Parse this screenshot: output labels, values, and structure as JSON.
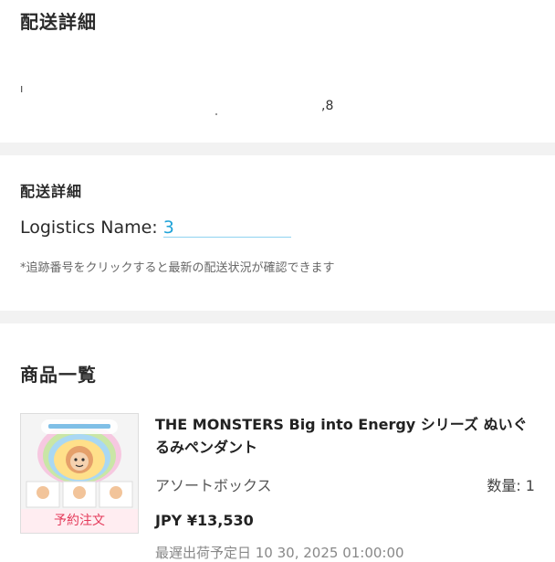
{
  "shipping_section": {
    "title": "配送詳細",
    "redacted_line_start": "ı",
    "redacted_line_end": ",8"
  },
  "logistics_section": {
    "title": "配送詳細",
    "logistics_label": "Logistics Name:",
    "tracking_link_text": "3",
    "note": "*追跡番号をクリックすると最新の配送状況が確認できます"
  },
  "products_section": {
    "title": "商品一覧",
    "items": [
      {
        "name": "THE MONSTERS Big into Energy シリーズ ぬいぐるみペンダント",
        "variant": "アソートボックス",
        "quantity_label": "数量: 1",
        "price": "JPY ¥13,530",
        "ship_date": "最遅出荷予定日 10 30, 2025 01:00:00",
        "badge": "予約注文"
      }
    ]
  },
  "colors": {
    "link": "#1fa3d8",
    "badge_text": "#e43a5a",
    "section_gap": "#f2f2f2"
  }
}
